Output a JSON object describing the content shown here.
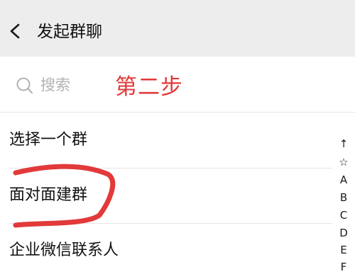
{
  "header": {
    "back_icon": "chevron-left-icon",
    "title": "发起群聊"
  },
  "search": {
    "icon": "search-icon",
    "placeholder": "搜索"
  },
  "annotation": {
    "step_label": "第二步",
    "color": "#e2393a"
  },
  "list": {
    "items": [
      {
        "label": "选择一个群"
      },
      {
        "label": "面对面建群"
      },
      {
        "label": "企业微信联系人"
      }
    ]
  },
  "index_bar": {
    "letters": [
      "↑",
      "☆",
      "A",
      "B",
      "C",
      "D",
      "E",
      "F"
    ]
  },
  "colors": {
    "header_bg": "#ededed",
    "text_primary": "#111111",
    "placeholder": "#b2b2b2",
    "divider": "#e6e6e6"
  }
}
